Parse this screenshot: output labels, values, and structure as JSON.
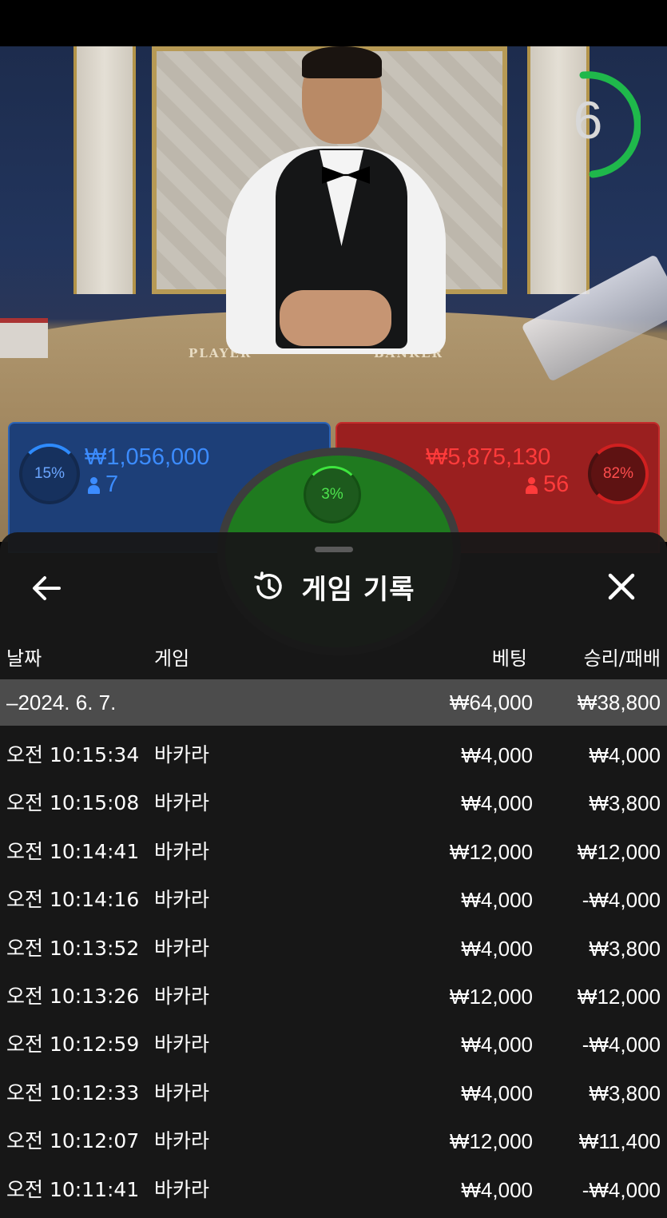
{
  "video": {
    "timer": "6",
    "table_words": [
      "PLAYER",
      "BANKER"
    ]
  },
  "bet_panels": {
    "player": {
      "percent": "15%",
      "amount": "₩1,056,000",
      "players": "7"
    },
    "tie": {
      "percent": "3%"
    },
    "banker": {
      "percent": "82%",
      "amount": "₩5,875,130",
      "players": "56"
    },
    "colors": {
      "player": "#1d3f78",
      "banker": "#9a1f1f",
      "tie": "#1f7a1f"
    }
  },
  "sheet": {
    "title": "게임 기록",
    "icons": {
      "back": "back-arrow-icon",
      "history": "history-icon",
      "close": "close-icon"
    },
    "columns": {
      "date": "날짜",
      "game": "게임",
      "bet": "베팅",
      "result": "승리/패배"
    },
    "summary": {
      "date": "–2024. 6. 7.",
      "bet": "₩64,000",
      "result": "₩38,800"
    },
    "rows": [
      {
        "time": "오전 10:15:34",
        "game": "바카라",
        "bet": "₩4,000",
        "result": "₩4,000"
      },
      {
        "time": "오전 10:15:08",
        "game": "바카라",
        "bet": "₩4,000",
        "result": "₩3,800"
      },
      {
        "time": "오전 10:14:41",
        "game": "바카라",
        "bet": "₩12,000",
        "result": "₩12,000"
      },
      {
        "time": "오전 10:14:16",
        "game": "바카라",
        "bet": "₩4,000",
        "result": "-₩4,000"
      },
      {
        "time": "오전 10:13:52",
        "game": "바카라",
        "bet": "₩4,000",
        "result": "₩3,800"
      },
      {
        "time": "오전 10:13:26",
        "game": "바카라",
        "bet": "₩12,000",
        "result": "₩12,000"
      },
      {
        "time": "오전 10:12:59",
        "game": "바카라",
        "bet": "₩4,000",
        "result": "-₩4,000"
      },
      {
        "time": "오전 10:12:33",
        "game": "바카라",
        "bet": "₩4,000",
        "result": "₩3,800"
      },
      {
        "time": "오전 10:12:07",
        "game": "바카라",
        "bet": "₩12,000",
        "result": "₩11,400"
      },
      {
        "time": "오전 10:11:41",
        "game": "바카라",
        "bet": "₩4,000",
        "result": "-₩4,000"
      }
    ]
  }
}
